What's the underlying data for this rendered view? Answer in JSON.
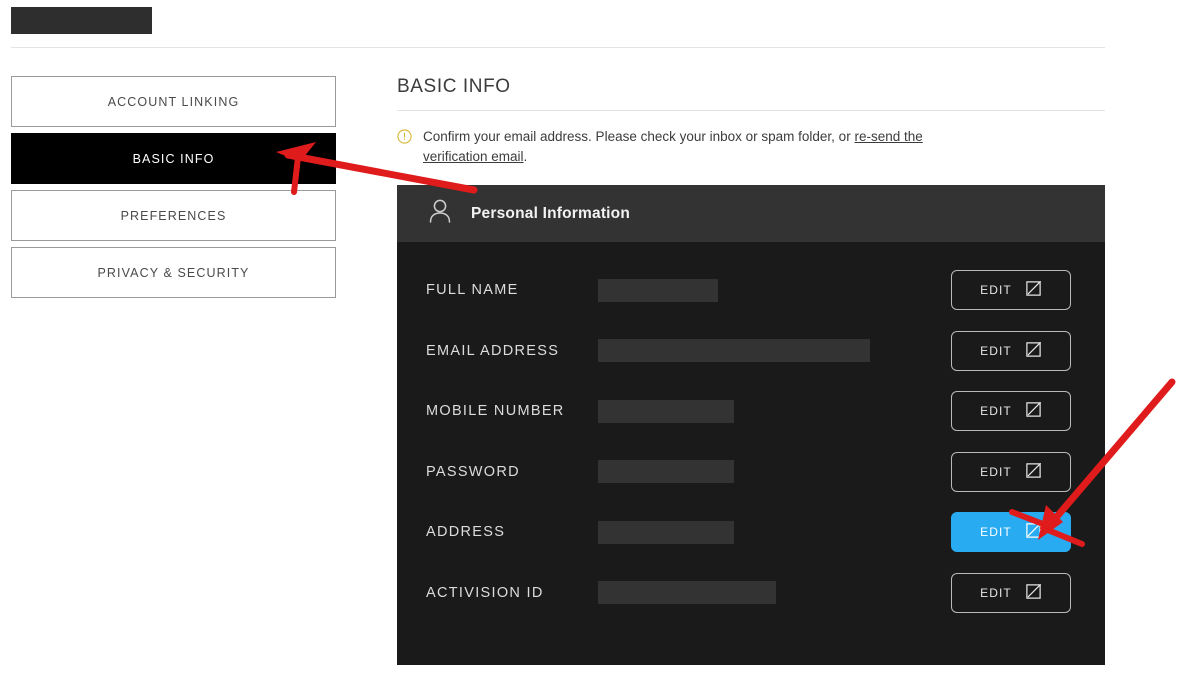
{
  "topbar": {
    "logo_redacted": true
  },
  "sidebar": {
    "items": [
      {
        "label": "ACCOUNT LINKING",
        "active": false
      },
      {
        "label": "BASIC INFO",
        "active": true
      },
      {
        "label": "PREFERENCES",
        "active": false
      },
      {
        "label": "PRIVACY & SECURITY",
        "active": false
      }
    ]
  },
  "main": {
    "title": "BASIC INFO",
    "alert": {
      "icon": "warning-circle-icon",
      "icon_color": "#d6b638",
      "text_before": "Confirm your email address. Please check your inbox or spam folder, or ",
      "link_text": "re-send the verification email",
      "text_after": "."
    },
    "card": {
      "header_icon": "person-icon",
      "header_title": "Personal Information",
      "edit_label": "EDIT",
      "edit_icon": "edit-pencil-square-icon",
      "highlight_color": "#29abf2",
      "rows": [
        {
          "label": "FULL NAME",
          "value_redacted_width": 120,
          "highlighted": false
        },
        {
          "label": "EMAIL ADDRESS",
          "value_redacted_width": 272,
          "highlighted": false
        },
        {
          "label": "MOBILE NUMBER",
          "value_redacted_width": 136,
          "highlighted": false
        },
        {
          "label": "PASSWORD",
          "value_redacted_width": 136,
          "highlighted": false
        },
        {
          "label": "ADDRESS",
          "value_redacted_width": 136,
          "highlighted": true
        },
        {
          "label": "ACTIVISION ID",
          "value_redacted_width": 178,
          "highlighted": false
        }
      ]
    }
  },
  "annotations": {
    "color": "#e01b1b",
    "arrows": [
      {
        "name": "arrow-to-basic-info",
        "target": "BASIC INFO"
      },
      {
        "name": "arrow-to-address-edit",
        "target": "ADDRESS EDIT"
      }
    ]
  }
}
